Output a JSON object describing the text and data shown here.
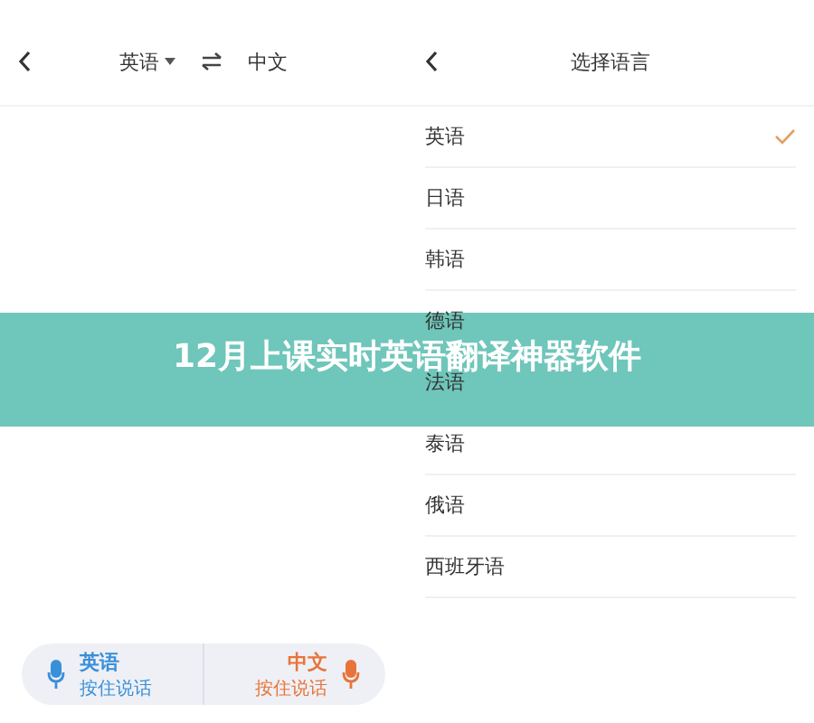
{
  "translator": {
    "source_language": "英语",
    "target_language": "中文",
    "voice_buttons": [
      {
        "language": "英语",
        "hint": "按住说话",
        "color": "#3a8fd9"
      },
      {
        "language": "中文",
        "hint": "按住说话",
        "color": "#e8743a"
      }
    ]
  },
  "language_picker": {
    "title": "选择语言",
    "languages": [
      {
        "label": "英语",
        "selected": true
      },
      {
        "label": "日语",
        "selected": false
      },
      {
        "label": "韩语",
        "selected": false
      },
      {
        "label": "德语",
        "selected": false
      },
      {
        "label": "法语",
        "selected": false
      },
      {
        "label": "泰语",
        "selected": false
      },
      {
        "label": "俄语",
        "selected": false
      },
      {
        "label": "西班牙语",
        "selected": false
      }
    ]
  },
  "banner": {
    "title": "12月上课实时英语翻译神器软件"
  }
}
